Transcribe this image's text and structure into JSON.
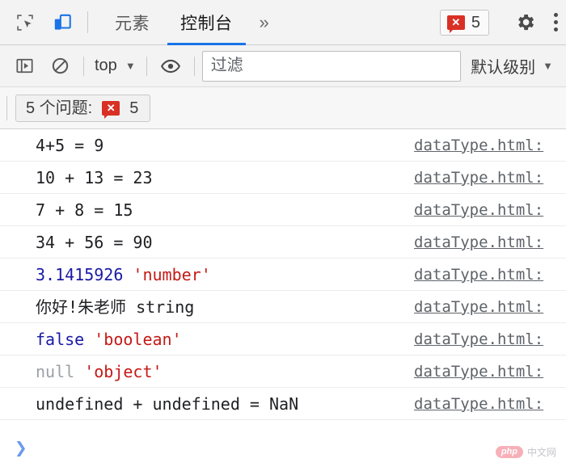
{
  "tabbar": {
    "inspect_icon": "inspect-element-icon",
    "device_icon": "device-toolbar-icon",
    "tabs": [
      {
        "label": "元素",
        "active": false
      },
      {
        "label": "控制台",
        "active": true
      }
    ],
    "more_tabs": "»",
    "error_badge": {
      "icon": "error-bubble-icon",
      "count": "5"
    },
    "settings_icon": "gear-icon",
    "menu_icon": "kebab-menu-icon"
  },
  "console_toolbar": {
    "sidebar_icon": "console-sidebar-icon",
    "clear_icon": "clear-console-icon",
    "context": {
      "label": "top",
      "caret": "▼"
    },
    "eye_icon": "live-expression-eye-icon",
    "filter": {
      "placeholder": "过滤",
      "value": ""
    },
    "level": {
      "label": "默认级别",
      "caret": "▼"
    }
  },
  "problems_bar": {
    "label": "5 个问题:",
    "error_icon": "error-bubble-icon",
    "error_count": "5"
  },
  "console_log": {
    "rows": [
      {
        "message": "4+5 = 9",
        "source": "dataType.html:",
        "tokens": [
          {
            "text": "4+5 = 9",
            "type": "plain"
          }
        ]
      },
      {
        "message": "10 + 13 = 23",
        "source": "dataType.html:",
        "tokens": [
          {
            "text": "10 + 13 = 23",
            "type": "plain"
          }
        ]
      },
      {
        "message": "7 + 8 = 15",
        "source": "dataType.html:",
        "tokens": [
          {
            "text": "7 + 8 = 15",
            "type": "plain"
          }
        ]
      },
      {
        "message": "34 + 56 = 90",
        "source": "dataType.html:",
        "tokens": [
          {
            "text": "34 + 56 = 90",
            "type": "plain"
          }
        ]
      },
      {
        "message": "3.1415926 'number'",
        "source": "dataType.html:",
        "tokens": [
          {
            "text": "3.1415926",
            "type": "num"
          },
          {
            "text": " ",
            "type": "plain"
          },
          {
            "text": "'number'",
            "type": "str"
          }
        ]
      },
      {
        "message": "你好!朱老师 string",
        "source": "dataType.html:",
        "tokens": [
          {
            "text": "你好!朱老师 string",
            "type": "plain"
          }
        ]
      },
      {
        "message": "false 'boolean'",
        "source": "dataType.html:",
        "tokens": [
          {
            "text": "false",
            "type": "bool"
          },
          {
            "text": " ",
            "type": "plain"
          },
          {
            "text": "'boolean'",
            "type": "str"
          }
        ]
      },
      {
        "message": "null 'object'",
        "source": "dataType.html:",
        "tokens": [
          {
            "text": "null",
            "type": "null"
          },
          {
            "text": " ",
            "type": "plain"
          },
          {
            "text": "'object'",
            "type": "str"
          }
        ]
      },
      {
        "message": "undefined + undefined = NaN",
        "source": "dataType.html:",
        "tokens": [
          {
            "text": "undefined + undefined = NaN",
            "type": "plain"
          }
        ]
      }
    ]
  },
  "prompt": {
    "caret": "❯",
    "value": ""
  },
  "watermark": {
    "logo": "php",
    "text": "中文网"
  },
  "colors": {
    "accent": "#1a73e8",
    "error": "#d93025",
    "number": "#1a1aa6",
    "string": "#c41a16",
    "null": "#9aa0a6",
    "toolbar_bg": "#f3f3f3"
  }
}
